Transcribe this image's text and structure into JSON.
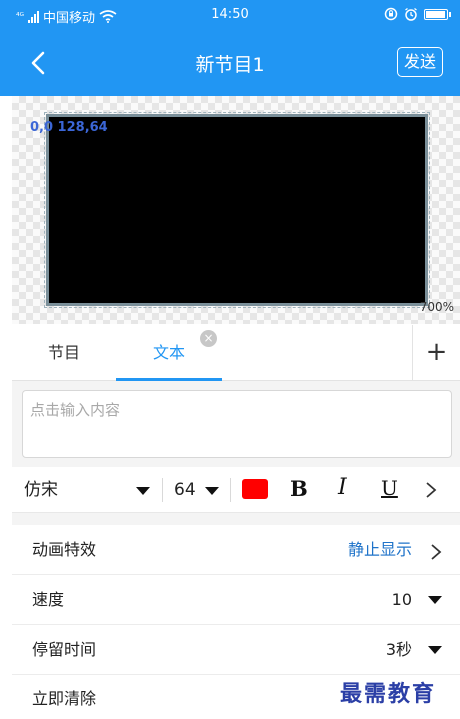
{
  "status_bar": {
    "signal_text": "⁴ᴳ",
    "carrier": "中国移动",
    "time": "14:50",
    "icons": [
      "signal-icon",
      "wifi-icon",
      "alarm-lock-icon",
      "alarm-clock-icon",
      "battery-icon"
    ]
  },
  "header": {
    "title": "新节目1",
    "send_label": "发送",
    "back_icon": "back-chevron-icon"
  },
  "preview": {
    "coord_label": "0,0 128,64",
    "zoom_label": "700%"
  },
  "tabs": [
    {
      "label": "节目",
      "active": false
    },
    {
      "label": "文本",
      "active": true
    }
  ],
  "tab_close_glyph": "×",
  "tab_add_glyph": "+",
  "text_input": {
    "value": "",
    "placeholder": "点击输入内容"
  },
  "toolbar": {
    "font": "仿宋",
    "size": "64",
    "color": "#ff0000",
    "bold_label": "B",
    "italic_label": "I",
    "underline_label": "U"
  },
  "settings": {
    "effect": {
      "label": "动画特效",
      "value": "静止显示"
    },
    "speed": {
      "label": "速度",
      "value": "10"
    },
    "dwell": {
      "label": "停留时间",
      "value": "3秒"
    },
    "clear": {
      "label": "立即清除"
    }
  },
  "watermark": "最需教育",
  "colors": {
    "primary": "#2196f3",
    "screen_bg": "#000000",
    "coord_text": "#3b66d6",
    "value_blue": "#1f73c9"
  }
}
